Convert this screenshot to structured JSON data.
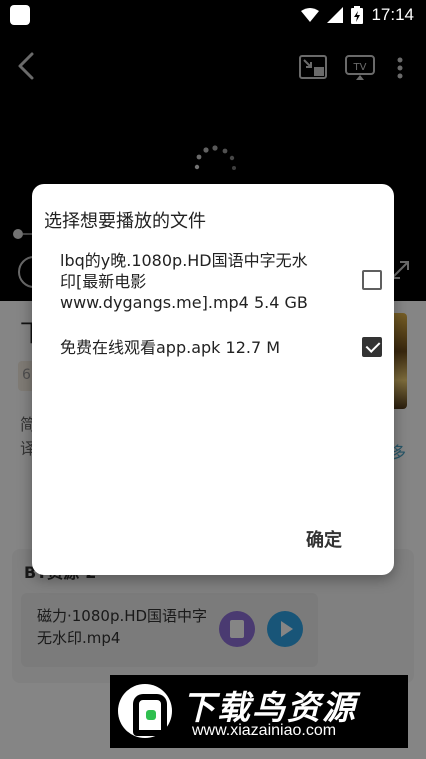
{
  "status_bar": {
    "time": "17:14",
    "icons": [
      "app-icon",
      "wifi-icon",
      "cellular-icon",
      "battery-charging-icon"
    ]
  },
  "player": {
    "icons": [
      "back-arrow-icon",
      "cast-screen-icon",
      "tv-icon",
      "more-vertical-icon",
      "loading-spinner-icon",
      "play-icon",
      "fullscreen-icon"
    ],
    "tv_label": "TV"
  },
  "background_page": {
    "title_fragment": "下",
    "badge_fragment": "6",
    "description_fragment": "简译",
    "more_link": "多",
    "bt_section_title": "BT资源·2",
    "bt_file": {
      "name": "磁力·1080p.HD国语中字无水印.mp4",
      "icons": [
        "copy-link-icon",
        "play-circle-icon"
      ]
    }
  },
  "dialog": {
    "title": "选择想要播放的文件",
    "options": [
      {
        "label": "lbq的y晚.1080p.HD国语中字无水印[最新电影www.dygangs.me].mp4 5.4 GB",
        "checked": false
      },
      {
        "label": "免费在线观看app.apk 12.7 M",
        "checked": true
      }
    ],
    "ok_label": "确定"
  },
  "watermark": {
    "title": "下载鸟资源",
    "url": "www.xiazainiao.com"
  }
}
